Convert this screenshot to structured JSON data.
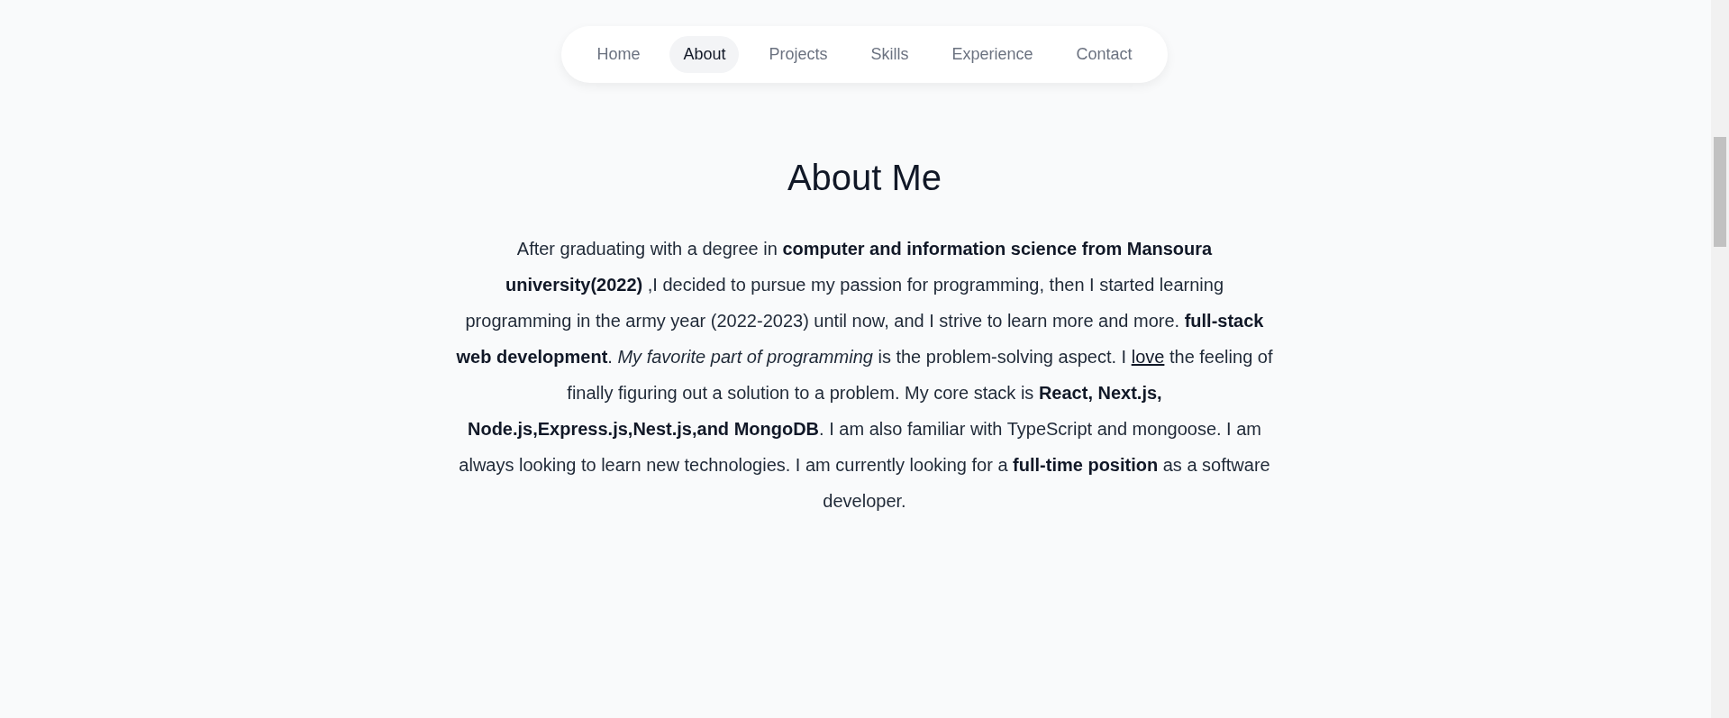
{
  "nav": [
    {
      "label": "Home",
      "selected": false
    },
    {
      "label": "About",
      "selected": true
    },
    {
      "label": "Projects",
      "selected": false
    },
    {
      "label": "Skills",
      "selected": false
    },
    {
      "label": "Experience",
      "selected": false
    },
    {
      "label": "Contact",
      "selected": false
    }
  ],
  "about": {
    "title": "About Me",
    "before_link": "After graduating with a degree in **computer and information science from Mansoura university(2022)** ,I decided to pursue my passion for programming, then I started learning programming in the army year (2022-2023) until now, and I strive to learn more and more. **full-stack web development**. *My favorite part of programming* is the problem-solving aspect. I",
    "link": "love",
    "after_link": "the feeling of finally figuring out a solution to a problem. My core stack is **React, Next.js, Node.js,Express.js,Nest.js,and MongoDB**. I am also familiar with TypeScript and mongoose. I am always looking to learn new technologies. I am currently looking for a **full-time position** as a software developer."
  }
}
